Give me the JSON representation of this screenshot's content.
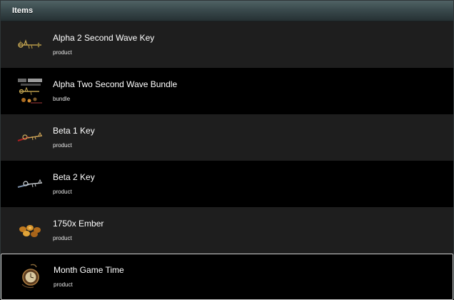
{
  "header": {
    "title": "Items"
  },
  "items": [
    {
      "name": "Alpha 2 Second Wave Key",
      "type": "product",
      "icon": "gold-key-icon"
    },
    {
      "name": "Alpha Two Second Wave Bundle",
      "type": "bundle",
      "icon": "bundle-icon"
    },
    {
      "name": "Beta 1 Key",
      "type": "product",
      "icon": "red-key-icon"
    },
    {
      "name": "Beta 2 Key",
      "type": "product",
      "icon": "silver-key-icon"
    },
    {
      "name": "1750x Ember",
      "type": "product",
      "icon": "ember-coins-icon"
    },
    {
      "name": "Month Game Time",
      "type": "product",
      "icon": "pocket-watch-icon"
    }
  ],
  "colors": {
    "header_top": "#506265",
    "header_bottom": "#263134",
    "row_odd": "#1e1e1e",
    "row_even": "#000000",
    "selected_border": "#cfcfcf",
    "text": "#ffffff"
  }
}
